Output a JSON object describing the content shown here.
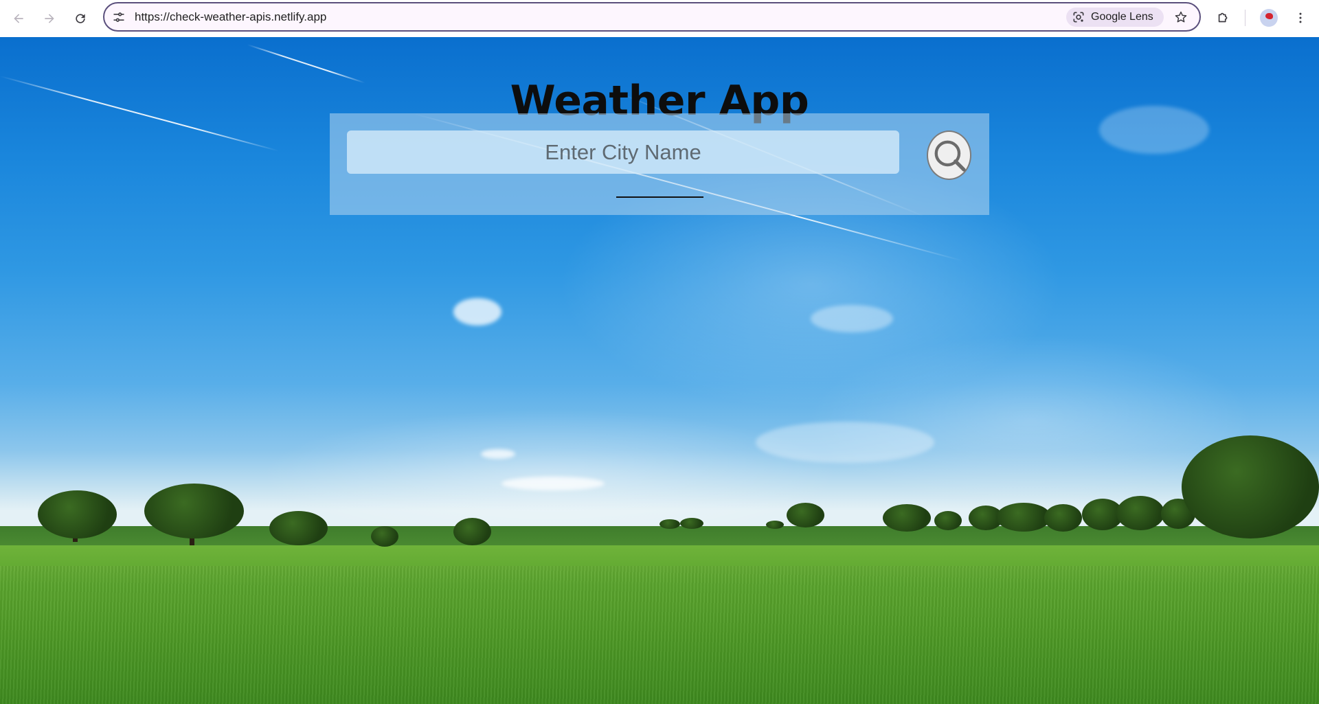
{
  "browser": {
    "url": "https://check-weather-apis.netlify.app",
    "lens_label": "Google Lens",
    "icons": {
      "back": "arrow-left-icon",
      "forward": "arrow-right-icon",
      "reload": "reload-icon",
      "site_info": "tune-icon",
      "lens": "google-lens-icon",
      "bookmark": "star-icon",
      "extensions": "puzzle-icon",
      "profile": "avatar",
      "menu": "kebab-menu-icon"
    }
  },
  "app": {
    "title": "Weather App",
    "search": {
      "placeholder": "Enter City Name",
      "value": "",
      "button_icon": "search-icon"
    }
  },
  "colors": {
    "omnibox_border": "#5a4f7c",
    "sky_top": "#0a6fce",
    "grass": "#5aa42d",
    "panel": "#b4d6ee"
  }
}
